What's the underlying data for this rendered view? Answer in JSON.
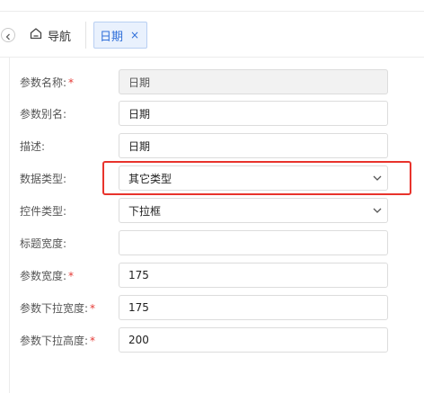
{
  "tabs": {
    "home_label": "导航",
    "active_label": "日期",
    "close_symbol": "×"
  },
  "form": {
    "param_name": {
      "label": "参数名称:",
      "required": "*",
      "value": "日期"
    },
    "param_alias": {
      "label": "参数别名:",
      "value": "日期"
    },
    "description": {
      "label": "描述:",
      "value": "日期"
    },
    "data_type": {
      "label": "数据类型:",
      "value": "其它类型"
    },
    "control_type": {
      "label": "控件类型:",
      "value": "下拉框"
    },
    "title_width": {
      "label": "标题宽度:",
      "value": ""
    },
    "param_width": {
      "label": "参数宽度:",
      "required": "*",
      "value": "175"
    },
    "dropdown_width": {
      "label": "参数下拉宽度:",
      "required": "*",
      "value": "175"
    },
    "dropdown_height": {
      "label": "参数下拉高度:",
      "required": "*",
      "value": "200"
    }
  },
  "colors": {
    "accent": "#2f6fd9",
    "highlight": "#e8332c",
    "required": "#e53935"
  }
}
